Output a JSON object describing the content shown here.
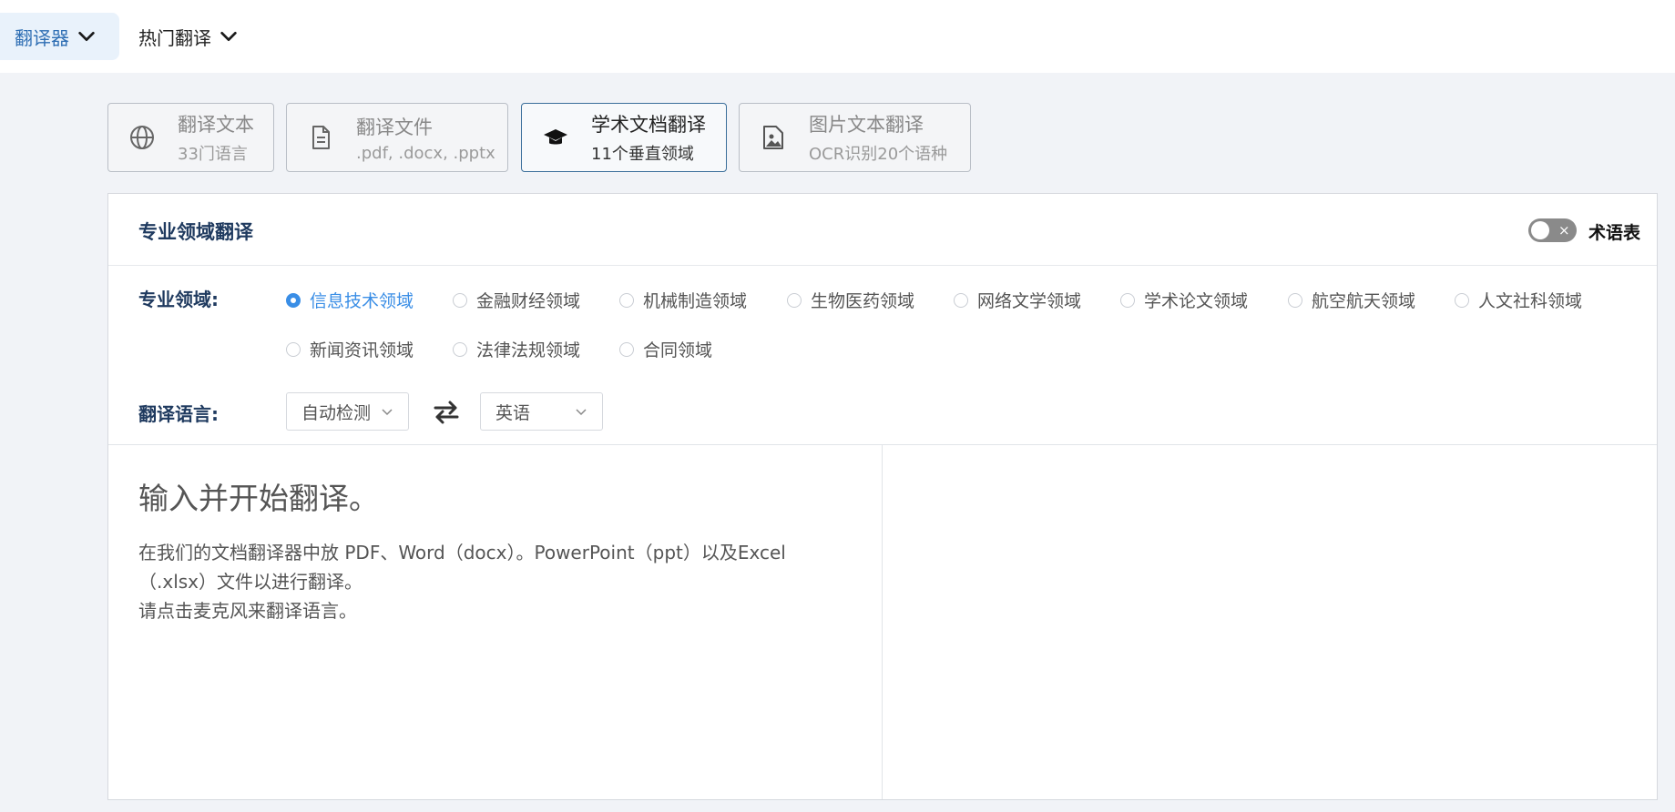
{
  "nav": {
    "translator": "翻译器",
    "hot": "热门翻译"
  },
  "modes": [
    {
      "title": "翻译文本",
      "subtitle": "33门语言",
      "icon": "globe-icon"
    },
    {
      "title": "翻译文件",
      "subtitle": ".pdf, .docx, .pptx",
      "icon": "document-icon"
    },
    {
      "title": "学术文档翻译",
      "subtitle": "11个垂直领域",
      "icon": "graduation-cap-icon"
    },
    {
      "title": "图片文本翻译",
      "subtitle": "OCR识别20个语种",
      "icon": "image-icon"
    }
  ],
  "panel": {
    "title": "专业领域翻译",
    "glossary": "术语表",
    "toggle_x": "×",
    "domain_label": "专业领域:",
    "domains": [
      "信息技术领域",
      "金融财经领域",
      "机械制造领域",
      "生物医药领域",
      "网络文学领域",
      "学术论文领域",
      "航空航天领域",
      "人文社科领域",
      "新闻资讯领域",
      "法律法规领域",
      "合同领域"
    ],
    "language_label": "翻译语言:",
    "source_lang": "自动检测",
    "target_lang": "英语"
  },
  "editor": {
    "placeholder": "输入并开始翻译。",
    "hint_line1": "在我们的文档翻译器中放 PDF、Word（docx）。PowerPoint（ppt）以及Excel（.xlsx）文件以进行翻译。",
    "hint_line2": "请点击麦克风来翻译语言。"
  },
  "colors": {
    "accent": "#3a8ee6",
    "title": "#1f3a5f",
    "background": "#f1f3f7"
  }
}
